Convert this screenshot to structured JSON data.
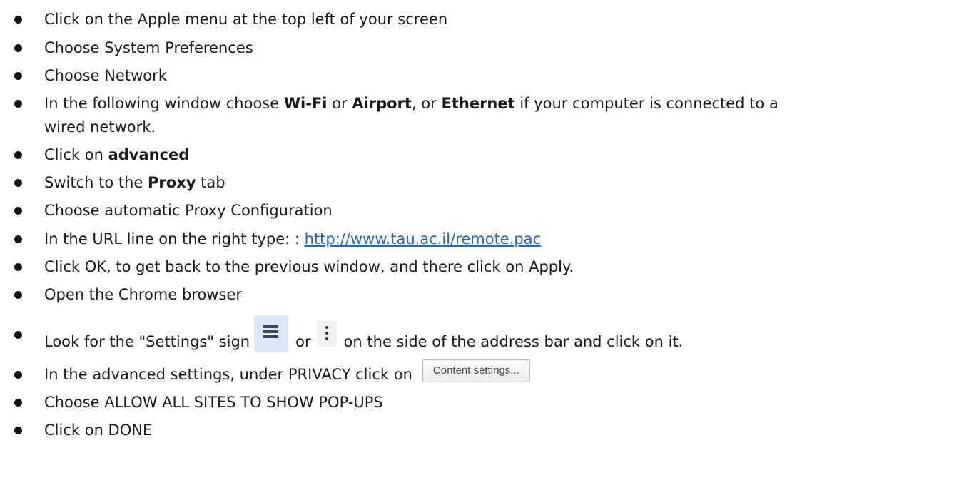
{
  "steps": [
    {
      "text": "Click on the Apple menu at the top left of your screen"
    },
    {
      "text": "Choose System Preferences"
    },
    {
      "text": "Choose Network"
    },
    {
      "t1": "In the following window choose ",
      "b1": "Wi-Fi",
      "t2": " or ",
      "b2": "Airport",
      "t3": ", or ",
      "b3": "Ethernet",
      "t4": " if your computer is connected to a",
      "t5": "wired network."
    },
    {
      "t1": "Click on ",
      "b1": "advanced"
    },
    {
      "t1": "Switch to the ",
      "b1": "Proxy",
      "t2": " tab"
    },
    {
      "text": "Choose automatic Proxy Configuration"
    },
    {
      "t1": "In the URL line on the right type: : ",
      "link": "http://www.tau.ac.il/remote.pac"
    },
    {
      "text": "Click OK, to get back to the previous window, and there click on Apply."
    },
    {
      "text": "Open the Chrome browser"
    },
    {
      "t1": "Look for the \"Settings\" sign",
      "t2": "or",
      "t3": "on the side of the address bar and click on it.",
      "icon1": "hamburger-menu-icon",
      "icon2": "vertical-dots-menu-icon"
    },
    {
      "t1": "In the advanced settings, under PRIVACY click on",
      "button": "Content settings..."
    },
    {
      "text": "Choose ALLOW ALL SITES TO SHOW POP-UPS"
    },
    {
      "text": "Click on DONE"
    }
  ],
  "colors": {
    "text": "#1a1a1a",
    "link": "#1f66c2",
    "icon_bg": "#dfe8f7"
  }
}
